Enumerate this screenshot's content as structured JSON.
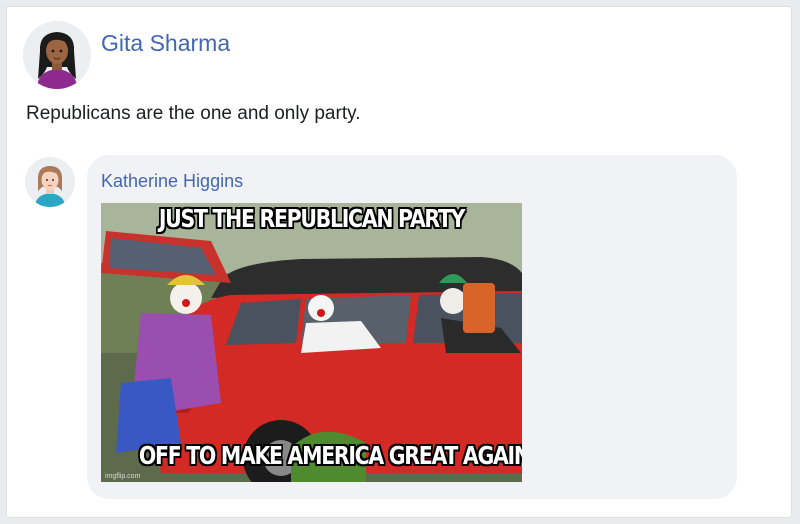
{
  "post": {
    "author": "Gita Sharma",
    "text": "Republicans are the one and only party."
  },
  "comment": {
    "author": "Katherine Higgins",
    "meme": {
      "top_caption": "JUST THE REPUBLICAN PARTY",
      "bottom_caption": "OFF TO MAKE AMERICA GREAT AGAIN",
      "watermark": "imgflip.com"
    }
  },
  "colors": {
    "name_link": "#4267b2",
    "bubble_bg": "#f0f2f5",
    "car_red": "#d32a25"
  }
}
